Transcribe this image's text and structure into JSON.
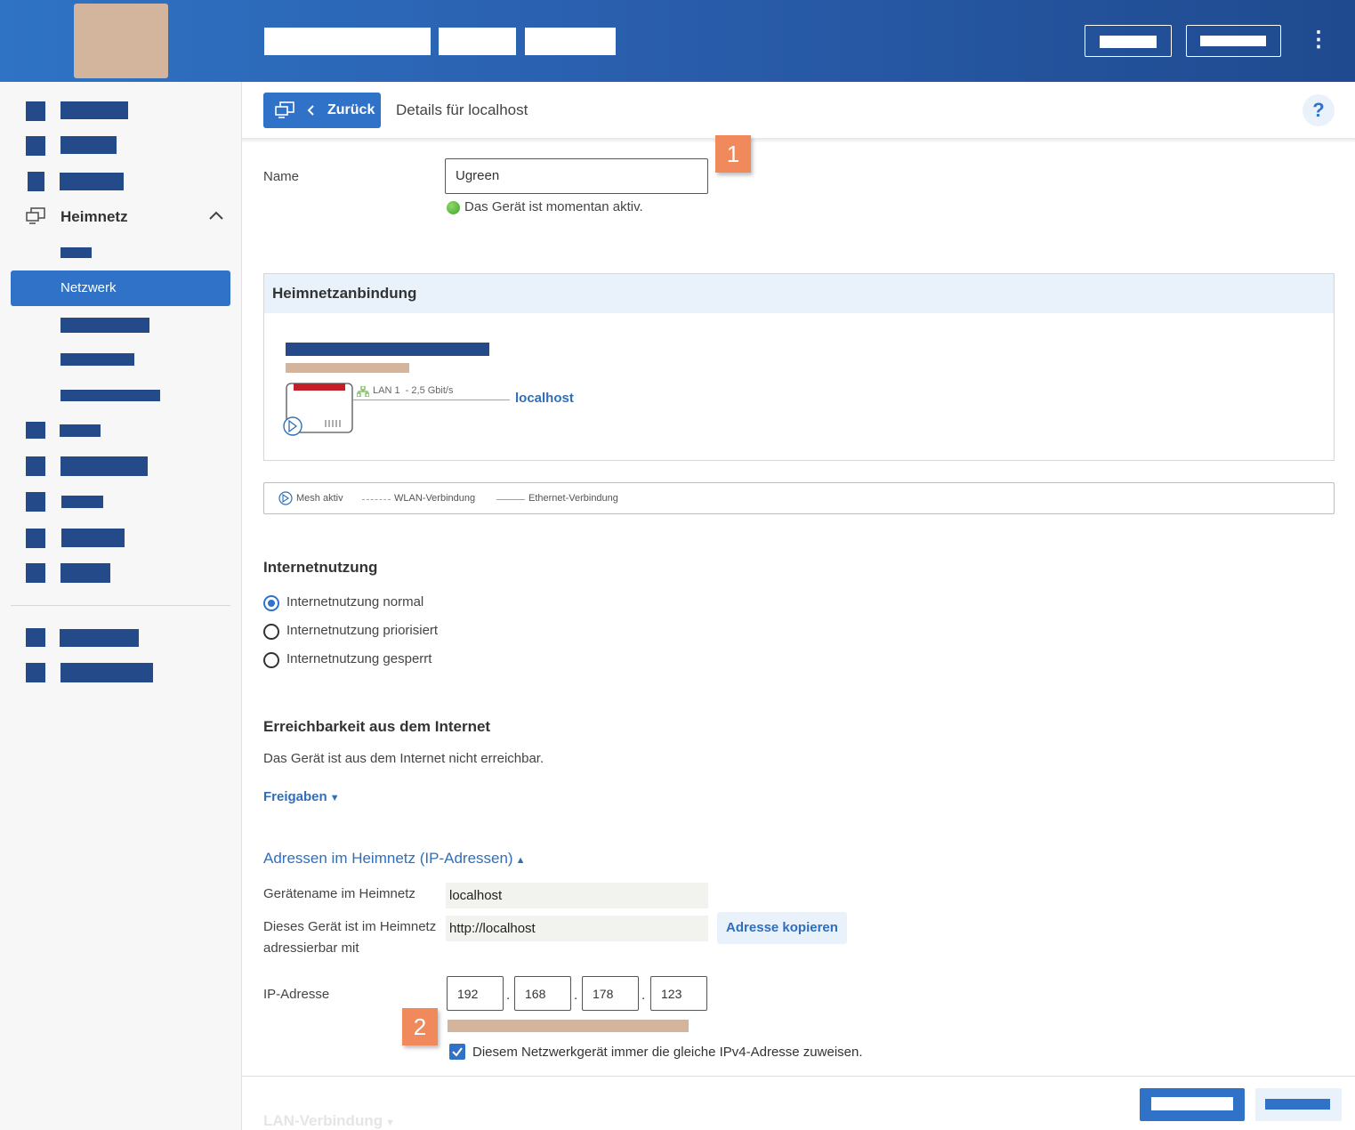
{
  "header": {
    "kebab_label": "⋮"
  },
  "sidebar": {
    "heimnetz_label": "Heimnetz",
    "active_item_label": "Netzwerk"
  },
  "toolbar": {
    "back_label": "Zurück",
    "page_title": "Details für localhost",
    "help_label": "?"
  },
  "badges": {
    "one": "1",
    "two": "2"
  },
  "device": {
    "name_label": "Name",
    "name_value": "Ugreen",
    "status_text": "Das Gerät ist momentan aktiv."
  },
  "connection_panel": {
    "title": "Heimnetzanbindung",
    "link_label": "LAN 1  - 2,5 Gbit/s",
    "host_label": "localhost"
  },
  "legend": {
    "mesh": "Mesh aktiv",
    "wlan": "WLAN-Verbindung",
    "ethernet": "Ethernet-Verbindung"
  },
  "internet_usage": {
    "title": "Internetnutzung",
    "options": [
      {
        "label": "Internetnutzung normal",
        "selected": true
      },
      {
        "label": "Internetnutzung priorisiert",
        "selected": false
      },
      {
        "label": "Internetnutzung gesperrt",
        "selected": false
      }
    ]
  },
  "reachability": {
    "title": "Erreichbarkeit aus dem Internet",
    "text": "Das Gerät ist aus dem Internet nicht erreichbar.",
    "freigaben_link": "Freigaben"
  },
  "addresses": {
    "title": "Adressen im Heimnetz (IP-Adressen)",
    "device_name_label": "Gerätename im Heimnetz",
    "device_name_value": "localhost",
    "address_label_1": "Dieses Gerät ist im Heimnetz",
    "address_label_2": "adressierbar mit",
    "address_value": "http://localhost",
    "copy_button": "Adresse kopieren",
    "ip_label": "IP-Adresse",
    "ip_octets": [
      "192",
      "168",
      "178",
      "123"
    ],
    "static_ip_checkbox": "Diesem Netzwerkgerät immer die gleiche IPv4-Adresse zuweisen.",
    "static_ip_checked": true
  },
  "footer": {
    "next_section": "LAN-Verbindung"
  },
  "colors": {
    "accent": "#2f72c8",
    "header_start": "#2f73c4",
    "header_end": "#1f4a8f",
    "badge": "#f08a5d"
  }
}
